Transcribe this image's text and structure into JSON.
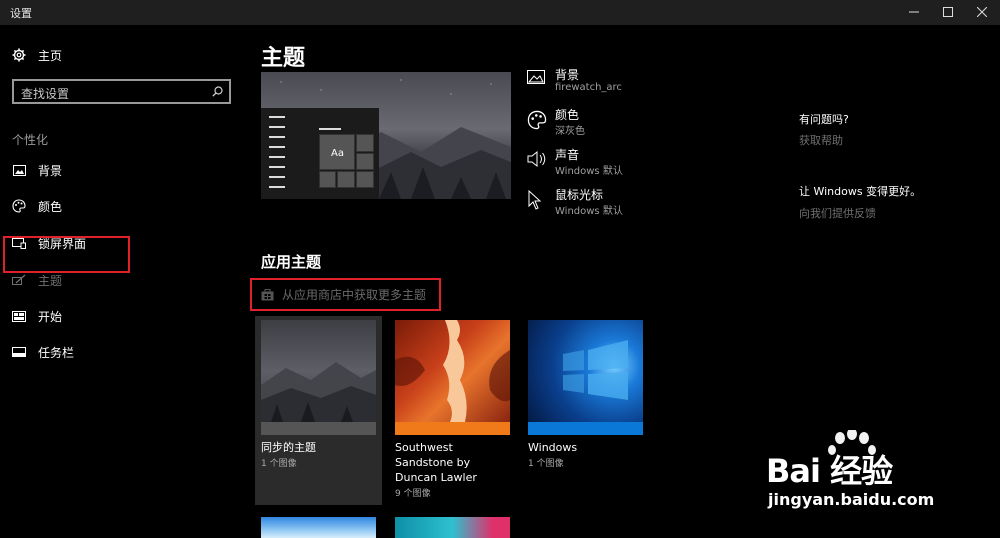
{
  "window": {
    "title": "设置"
  },
  "sidebar": {
    "home": "主页",
    "search_placeholder": "查找设置",
    "section": "个性化",
    "items": [
      {
        "label": "背景",
        "icon": "picture-icon"
      },
      {
        "label": "颜色",
        "icon": "palette-icon"
      },
      {
        "label": "锁屏界面",
        "icon": "lock-screen-icon"
      },
      {
        "label": "主题",
        "icon": "brush-icon",
        "selected": true
      },
      {
        "label": "开始",
        "icon": "start-icon"
      },
      {
        "label": "任务栏",
        "icon": "taskbar-icon"
      }
    ]
  },
  "main": {
    "title": "主题",
    "properties": [
      {
        "name": "背景",
        "value": "firewatch_arc",
        "icon": "picture-icon"
      },
      {
        "name": "颜色",
        "value": "深灰色",
        "icon": "palette-icon"
      },
      {
        "name": "声音",
        "value": "Windows 默认",
        "icon": "speaker-icon"
      },
      {
        "name": "鼠标光标",
        "value": "Windows 默认",
        "icon": "cursor-icon"
      }
    ],
    "preview_text": "Aa",
    "apply_heading": "应用主题",
    "store_link": "从应用商店中获取更多主题",
    "themes": [
      {
        "name": "同步的主题",
        "count": "1 个图像"
      },
      {
        "name": "Southwest Sandstone by Duncan Lawler",
        "count": "9 个图像"
      },
      {
        "name": "Windows",
        "count": "1 个图像"
      }
    ]
  },
  "help": {
    "question": "有问题吗?",
    "get_help": "获取帮助",
    "improve": "让 Windows 变得更好。",
    "feedback": "向我们提供反馈"
  },
  "watermark": {
    "brand": "Bai 经验",
    "url": "jingyan.baidu.com"
  },
  "colors": {
    "accent_red": "#e0202a",
    "windows_blue": "#0a78d7",
    "sandstone_orange": "#f07a1a"
  }
}
